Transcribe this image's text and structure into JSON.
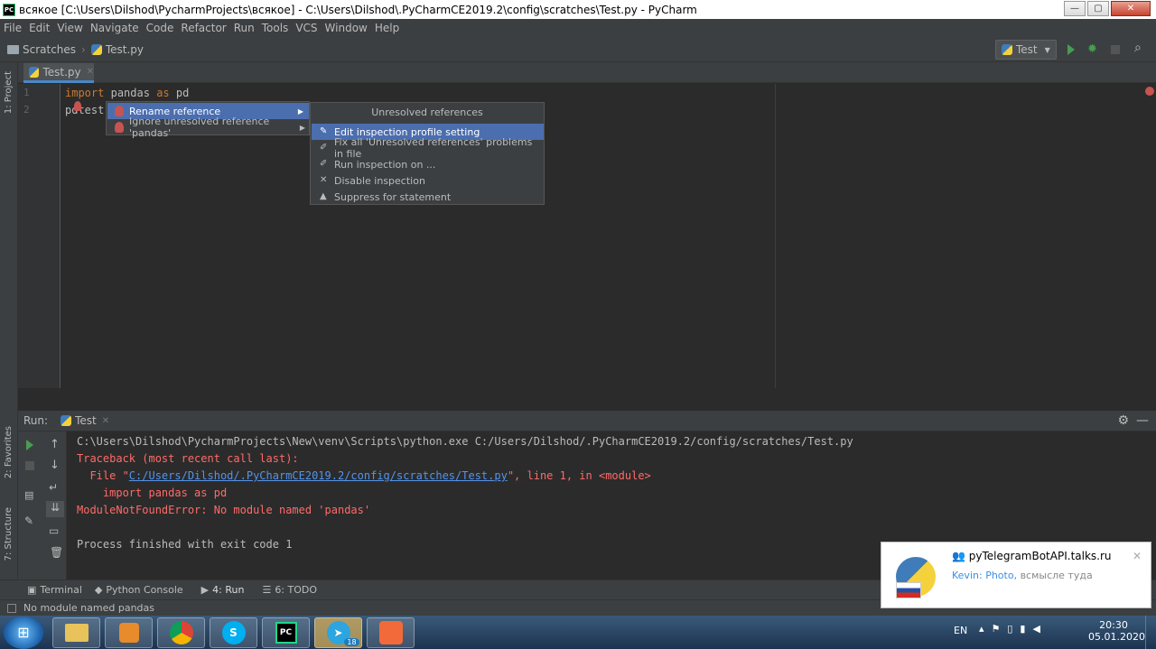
{
  "window": {
    "title": "всякое [C:\\Users\\Dilshod\\PycharmProjects\\всякое] - C:\\Users\\Dilshod\\.PyCharmCE2019.2\\config\\scratches\\Test.py - PyCharm"
  },
  "menu": [
    "File",
    "Edit",
    "View",
    "Navigate",
    "Code",
    "Refactor",
    "Run",
    "Tools",
    "VCS",
    "Window",
    "Help"
  ],
  "breadcrumb": {
    "root": "Scratches",
    "file": "Test.py"
  },
  "run_config": {
    "name": "Test"
  },
  "left_strip": {
    "project": "1: Project",
    "favorites": "2: Favorites",
    "structure": "7: Structure"
  },
  "editor": {
    "tab": "Test.py",
    "line_numbers": [
      "1",
      "2"
    ],
    "line1": {
      "kw_import": "import",
      "mod": "pandas",
      "kw_as": "as",
      "alias": "pd"
    },
    "line2": {
      "a": "pd",
      "b": "test"
    }
  },
  "context_menu": {
    "items": [
      "Rename reference",
      "Ignore unresolved reference 'pandas'"
    ]
  },
  "submenu": {
    "title": "Unresolved references",
    "items": [
      "Edit inspection profile setting",
      "Fix all 'Unresolved references' problems in file",
      "Run inspection on ...",
      "Disable inspection",
      "Suppress for statement"
    ]
  },
  "run_panel": {
    "label": "Run:",
    "tab": "Test"
  },
  "console": {
    "line1": "C:\\Users\\Dilshod\\PycharmProjects\\New\\venv\\Scripts\\python.exe C:/Users/Dilshod/.PyCharmCE2019.2/config/scratches/Test.py",
    "line2": "Traceback (most recent call last):",
    "line3_prefix": "  File \"",
    "line3_link": "C:/Users/Dilshod/.PyCharmCE2019.2/config/scratches/Test.py",
    "line3_suffix": "\", line 1, in <module>",
    "line4": "    import pandas as pd",
    "line5": "ModuleNotFoundError: No module named 'pandas'",
    "line7": "Process finished with exit code 1"
  },
  "bottom_tabs": [
    "Terminal",
    "Python Console",
    "4: Run",
    "6: TODO"
  ],
  "status": {
    "message": "No module named pandas"
  },
  "notification": {
    "title": "pyTelegramBotAPI.talks.ru",
    "sender": "Kevin:",
    "photo": "Photo,",
    "text": "всмысле туда"
  },
  "tray": {
    "lang": "EN",
    "time": "20:30",
    "date": "05.01.2020",
    "badge": "18"
  },
  "colors": {
    "accent": "#4b6eaf",
    "error": "#ff6b68",
    "link": "#5394ec",
    "keyword": "#cc7832"
  }
}
